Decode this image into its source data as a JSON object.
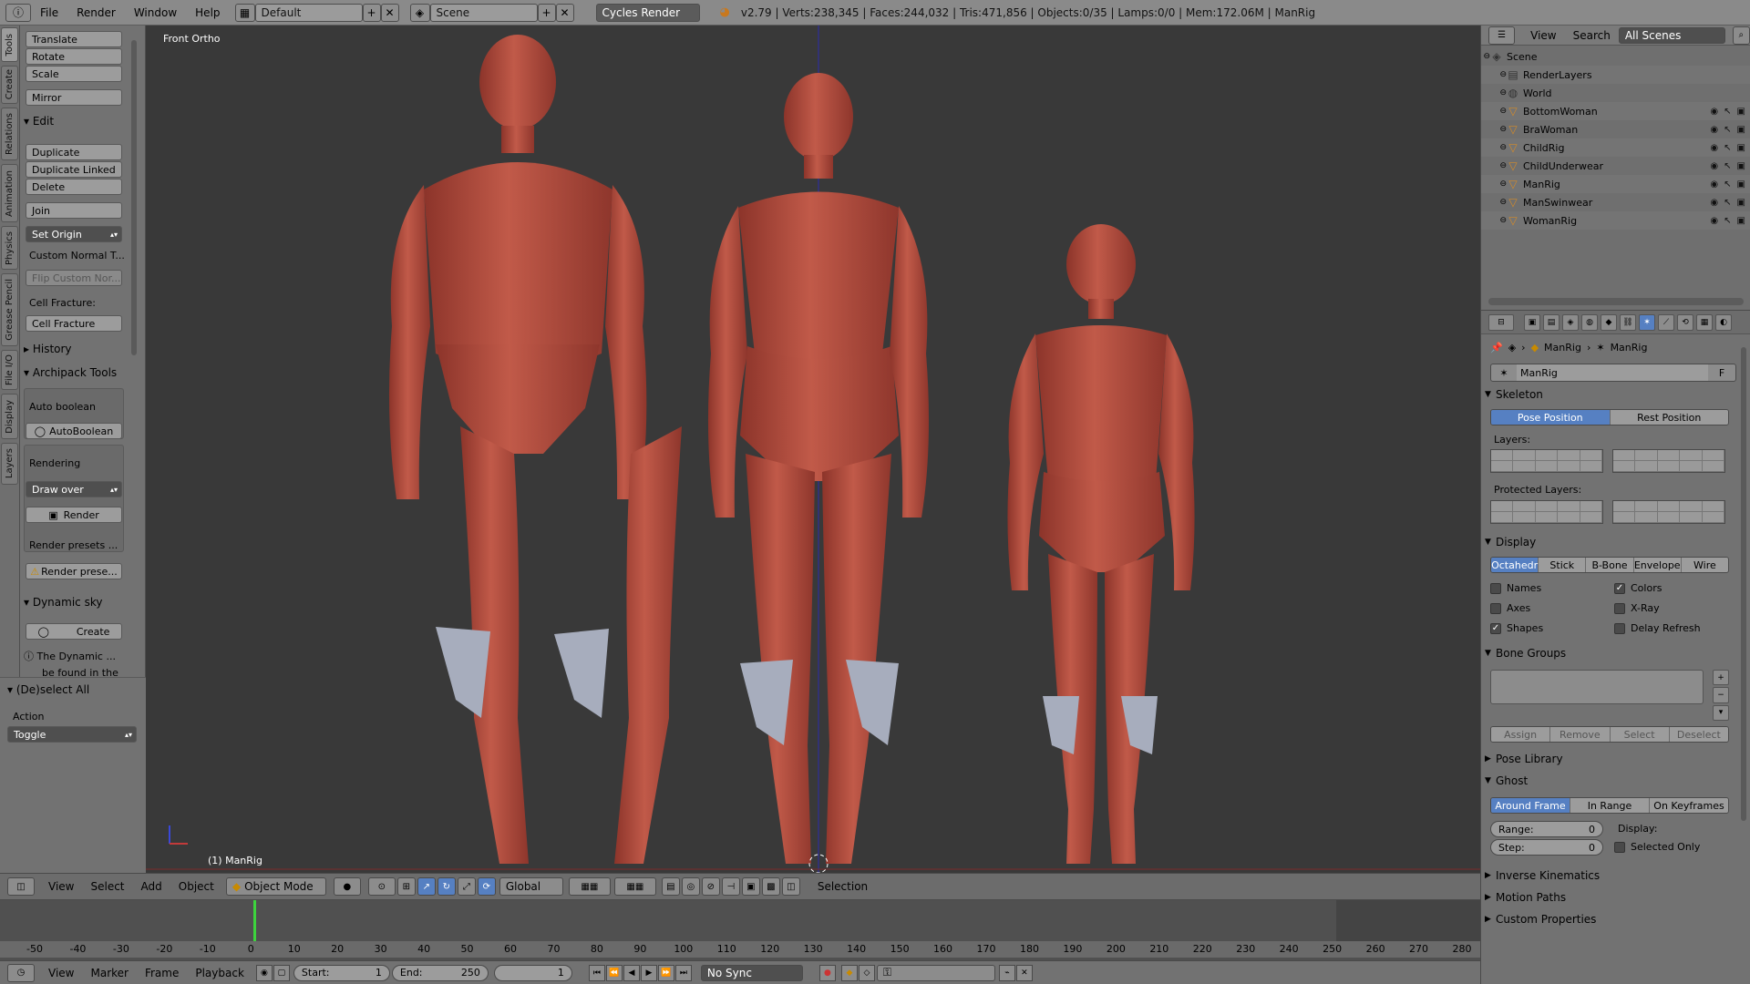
{
  "topbar": {
    "menus": [
      "File",
      "Render",
      "Window",
      "Help"
    ],
    "layout": "Default",
    "scene": "Scene",
    "engine": "Cycles Render",
    "stats": "v2.79 | Verts:238,345 | Faces:244,032 | Tris:471,856 | Objects:0/35 | Lamps:0/0 | Mem:172.06M | ManRig"
  },
  "tabs": [
    "Tools",
    "Create",
    "Relations",
    "Animation",
    "Physics",
    "Grease Pencil",
    "File I/O",
    "Display",
    "Layers"
  ],
  "tools": {
    "translate": "Translate",
    "rotate": "Rotate",
    "scale": "Scale",
    "mirror": "Mirror",
    "edit_head": "Edit",
    "duplicate": "Duplicate",
    "duplicate_linked": "Duplicate Linked",
    "delete": "Delete",
    "join": "Join",
    "set_origin": "Set Origin",
    "custom_normal": "Custom Normal T...",
    "flip_custom": "Flip Custom Nor...",
    "cell_fracture_label": "Cell Fracture:",
    "cell_fracture": "Cell Fracture",
    "history_head": "History",
    "archipack_head": "Archipack Tools",
    "auto_boolean_label": "Auto boolean",
    "auto_boolean": "AutoBoolean",
    "rendering_label": "Rendering",
    "draw_over": "Draw over",
    "render": "Render",
    "render_presets_label": "Render presets ...",
    "render_presets": "Render prese...",
    "dynamic_sky_head": "Dynamic sky",
    "create": "Create",
    "dyn_info1": "The Dynamic ...",
    "dyn_info2": "be found in the"
  },
  "deselect": {
    "head": "(De)select All",
    "action_label": "Action",
    "action_value": "Toggle"
  },
  "viewport": {
    "view_name": "Front Ortho",
    "active": "(1) ManRig"
  },
  "header": {
    "menus": [
      "View",
      "Select",
      "Add",
      "Object"
    ],
    "mode": "Object Mode",
    "orientation": "Global",
    "selection": "Selection"
  },
  "timeline": {
    "ticks": [
      "-50",
      "-40",
      "-30",
      "-20",
      "-10",
      "0",
      "10",
      "20",
      "30",
      "40",
      "50",
      "60",
      "70",
      "80",
      "90",
      "100",
      "110",
      "120",
      "130",
      "140",
      "150",
      "160",
      "170",
      "180",
      "190",
      "200",
      "210",
      "220",
      "230",
      "240",
      "250",
      "260",
      "270",
      "280"
    ],
    "current_frame": 1
  },
  "playbar": {
    "menus": [
      "View",
      "Marker",
      "Frame",
      "Playback"
    ],
    "start_label": "Start:",
    "start": "1",
    "end_label": "End:",
    "end": "250",
    "frame": "1",
    "sync": "No Sync"
  },
  "outliner": {
    "menus": [
      "View",
      "Search"
    ],
    "scenes": "All Scenes",
    "rows": [
      "Scene",
      "RenderLayers",
      "World",
      "BottomWoman",
      "BraWoman",
      "ChildRig",
      "ChildUnderwear",
      "ManRig",
      "ManSwinwear",
      "WomanRig"
    ]
  },
  "props": {
    "breadcrumb1": "ManRig",
    "breadcrumb2": "ManRig",
    "data_name": "ManRig",
    "fake_user": "F",
    "skeleton_head": "Skeleton",
    "pose_position": "Pose Position",
    "rest_position": "Rest Position",
    "layers_label": "Layers:",
    "protected_label": "Protected Layers:",
    "display_head": "Display",
    "display_modes": [
      "Octahedr",
      "Stick",
      "B-Bone",
      "Envelope",
      "Wire"
    ],
    "names": "Names",
    "axes": "Axes",
    "shapes": "Shapes",
    "colors": "Colors",
    "xray": "X-Ray",
    "delay_refresh": "Delay Refresh",
    "bone_groups_head": "Bone Groups",
    "assign": "Assign",
    "remove": "Remove",
    "select": "Select",
    "deselect": "Deselect",
    "pose_library_head": "Pose Library",
    "ghost_head": "Ghost",
    "ghost_modes": [
      "Around Frame",
      "In Range",
      "On Keyframes"
    ],
    "range_label": "Range:",
    "range_value": "0",
    "step_label": "Step:",
    "step_value": "0",
    "display_label": "Display:",
    "selected_only": "Selected Only",
    "ik_head": "Inverse Kinematics",
    "motion_paths_head": "Motion Paths",
    "custom_props_head": "Custom Properties"
  },
  "colors": {
    "accent": "#5680c2",
    "skin": "#b24c3e"
  }
}
